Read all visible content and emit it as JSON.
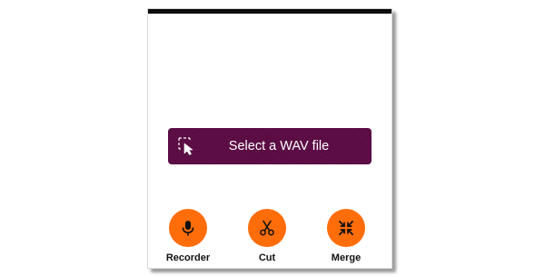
{
  "main": {
    "select_button_label": "Select a WAV file",
    "select_icon": "select-cursor-icon",
    "button_color": "#5a0a42"
  },
  "tools": {
    "accent_color": "#ff6d0a",
    "recorder": {
      "label": "Recorder",
      "icon": "microphone-icon"
    },
    "cut": {
      "label": "Cut",
      "icon": "scissors-icon"
    },
    "merge": {
      "label": "Merge",
      "icon": "merge-arrows-icon"
    }
  }
}
